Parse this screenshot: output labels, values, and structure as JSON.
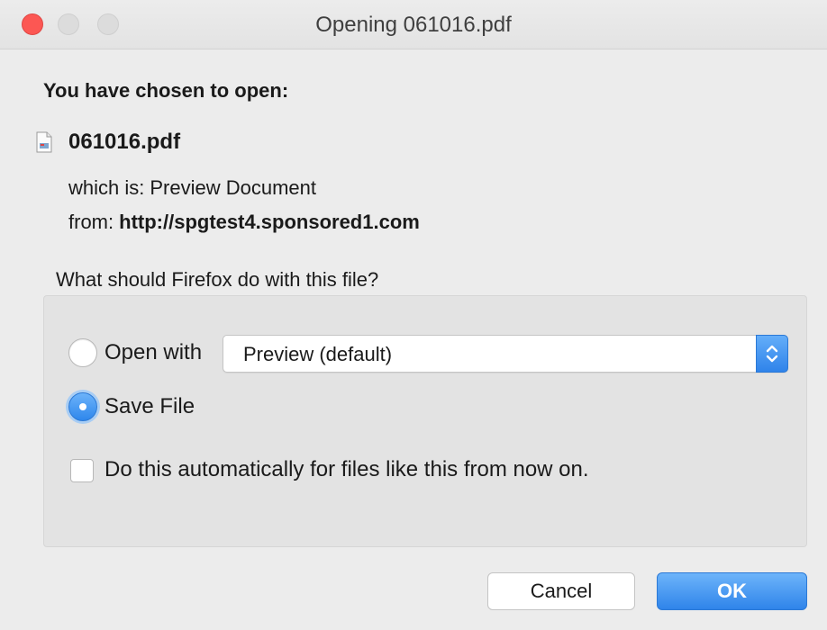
{
  "window": {
    "title": "Opening 061016.pdf",
    "controls": [
      "close",
      "minimize",
      "maximize"
    ]
  },
  "dialog": {
    "heading": "You have chosen to open:",
    "file": {
      "name": "061016.pdf",
      "icon": "pdf-file-icon",
      "which_is_label": "which is:",
      "which_is_value": "Preview Document",
      "from_label": "from:",
      "from_value": "http://spgtest4.sponsored1.com"
    },
    "question": "What should Firefox do with this file?",
    "options": {
      "open_with_label": "Open with",
      "open_with_selected": false,
      "open_with_app": "Preview (default)",
      "save_file_label": "Save File",
      "save_file_selected": true,
      "auto_label": "Do this automatically for files like this from now on.",
      "auto_checked": false
    },
    "buttons": {
      "cancel": "Cancel",
      "ok": "OK"
    }
  },
  "colors": {
    "accent": "#2f87ec",
    "close_button": "#fc5753",
    "background": "#ececec"
  }
}
